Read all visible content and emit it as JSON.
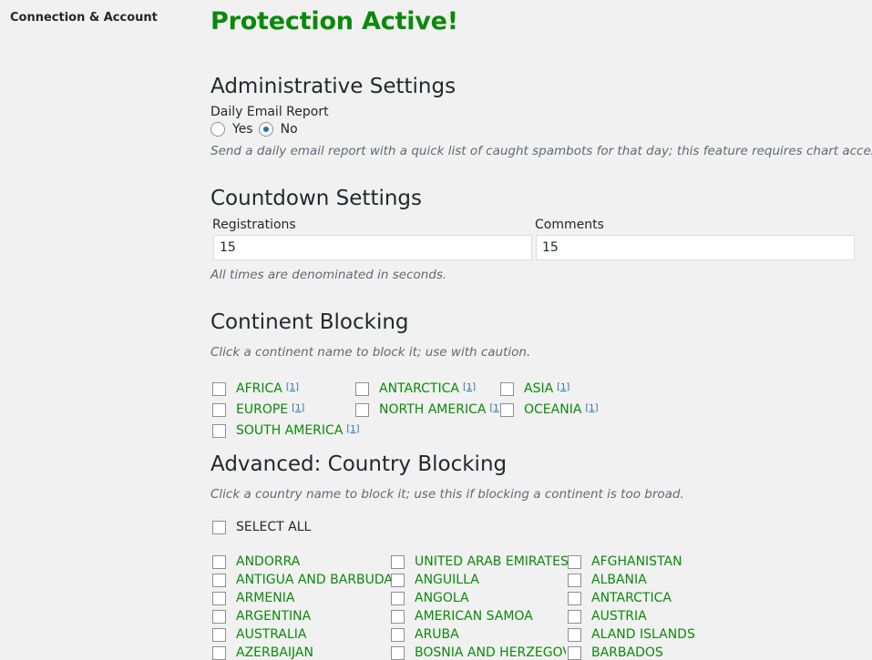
{
  "sidebar": {
    "link_label": "Connection & Account"
  },
  "headline": "Protection Active!",
  "admin": {
    "title": "Administrative Settings",
    "daily_email_label": "Daily Email Report",
    "yes_label": "Yes",
    "no_label": "No",
    "selected": "No",
    "description": "Send a daily email report with a quick list of caught spambots for that day; this feature requires chart access."
  },
  "countdown": {
    "title": "Countdown Settings",
    "registrations_label": "Registrations",
    "registrations_value": "15",
    "comments_label": "Comments",
    "comments_value": "15",
    "description": "All times are denominated in seconds."
  },
  "continent": {
    "title": "Continent Blocking",
    "description": "Click a continent name to block it; use with caution.",
    "footnote": "[1]",
    "items": [
      "AFRICA",
      "ANTARCTICA",
      "ASIA",
      "EUROPE",
      "NORTH AMERICA",
      "OCEANIA",
      "SOUTH AMERICA"
    ]
  },
  "country": {
    "title": "Advanced: Country Blocking",
    "description": "Click a country name to block it; use this if blocking a continent is too broad.",
    "select_all_label": "SELECT ALL",
    "col1": [
      "ANDORRA",
      "ANTIGUA AND BARBUDA",
      "ARMENIA",
      "ARGENTINA",
      "AUSTRALIA",
      "AZERBAIJAN"
    ],
    "col2": [
      "UNITED ARAB EMIRATES",
      "ANGUILLA",
      "ANGOLA",
      "AMERICAN SAMOA",
      "ARUBA",
      "BOSNIA AND HERZEGOVI"
    ],
    "col3": [
      "AFGHANISTAN",
      "ALBANIA",
      "ANTARCTICA",
      "AUSTRIA",
      "ALAND ISLANDS",
      "BARBADOS"
    ]
  },
  "colors": {
    "accent_green": "#0a8a0a",
    "link_blue": "#2271b1",
    "background": "#f1f1f1"
  }
}
